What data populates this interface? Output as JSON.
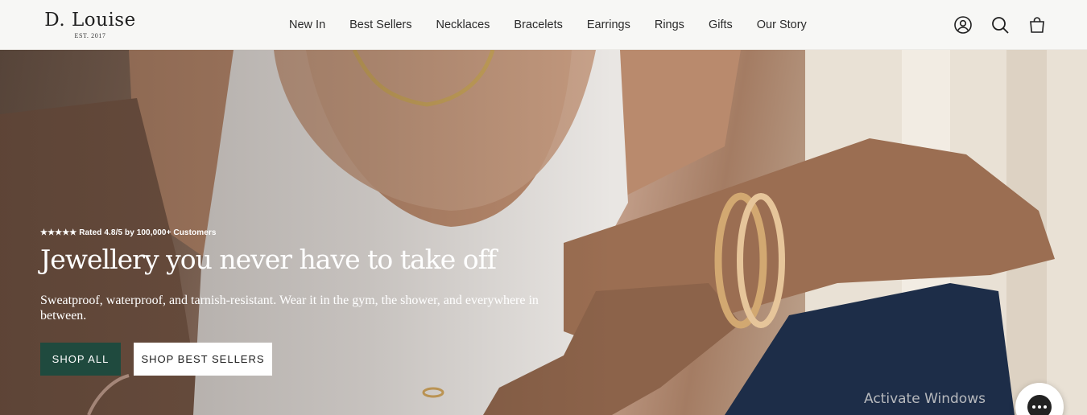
{
  "header": {
    "logo_name": "D. Louise",
    "logo_tagline": "EST. 2017",
    "nav": [
      {
        "label": "New In"
      },
      {
        "label": "Best Sellers"
      },
      {
        "label": "Necklaces"
      },
      {
        "label": "Bracelets"
      },
      {
        "label": "Earrings"
      },
      {
        "label": "Rings"
      },
      {
        "label": "Gifts"
      },
      {
        "label": "Our Story"
      }
    ],
    "icons": [
      "account-icon",
      "search-icon",
      "cart-icon"
    ]
  },
  "hero": {
    "rating": "★★★★★ Rated 4.8/5 by 100,000+ Customers",
    "headline": "Jewellery you never have to take off",
    "subline": "Sweatproof, waterproof, and tarnish-resistant. Wear it in the gym, the shower, and everywhere in between.",
    "primary_button": "SHOP ALL",
    "secondary_button": "SHOP BEST SELLERS"
  },
  "overlay": {
    "watermark": "Activate Windows"
  },
  "colors": {
    "header_bg": "#f7f7f5",
    "primary_button_bg": "#1f4a3e",
    "text_on_hero": "#ffffff"
  }
}
